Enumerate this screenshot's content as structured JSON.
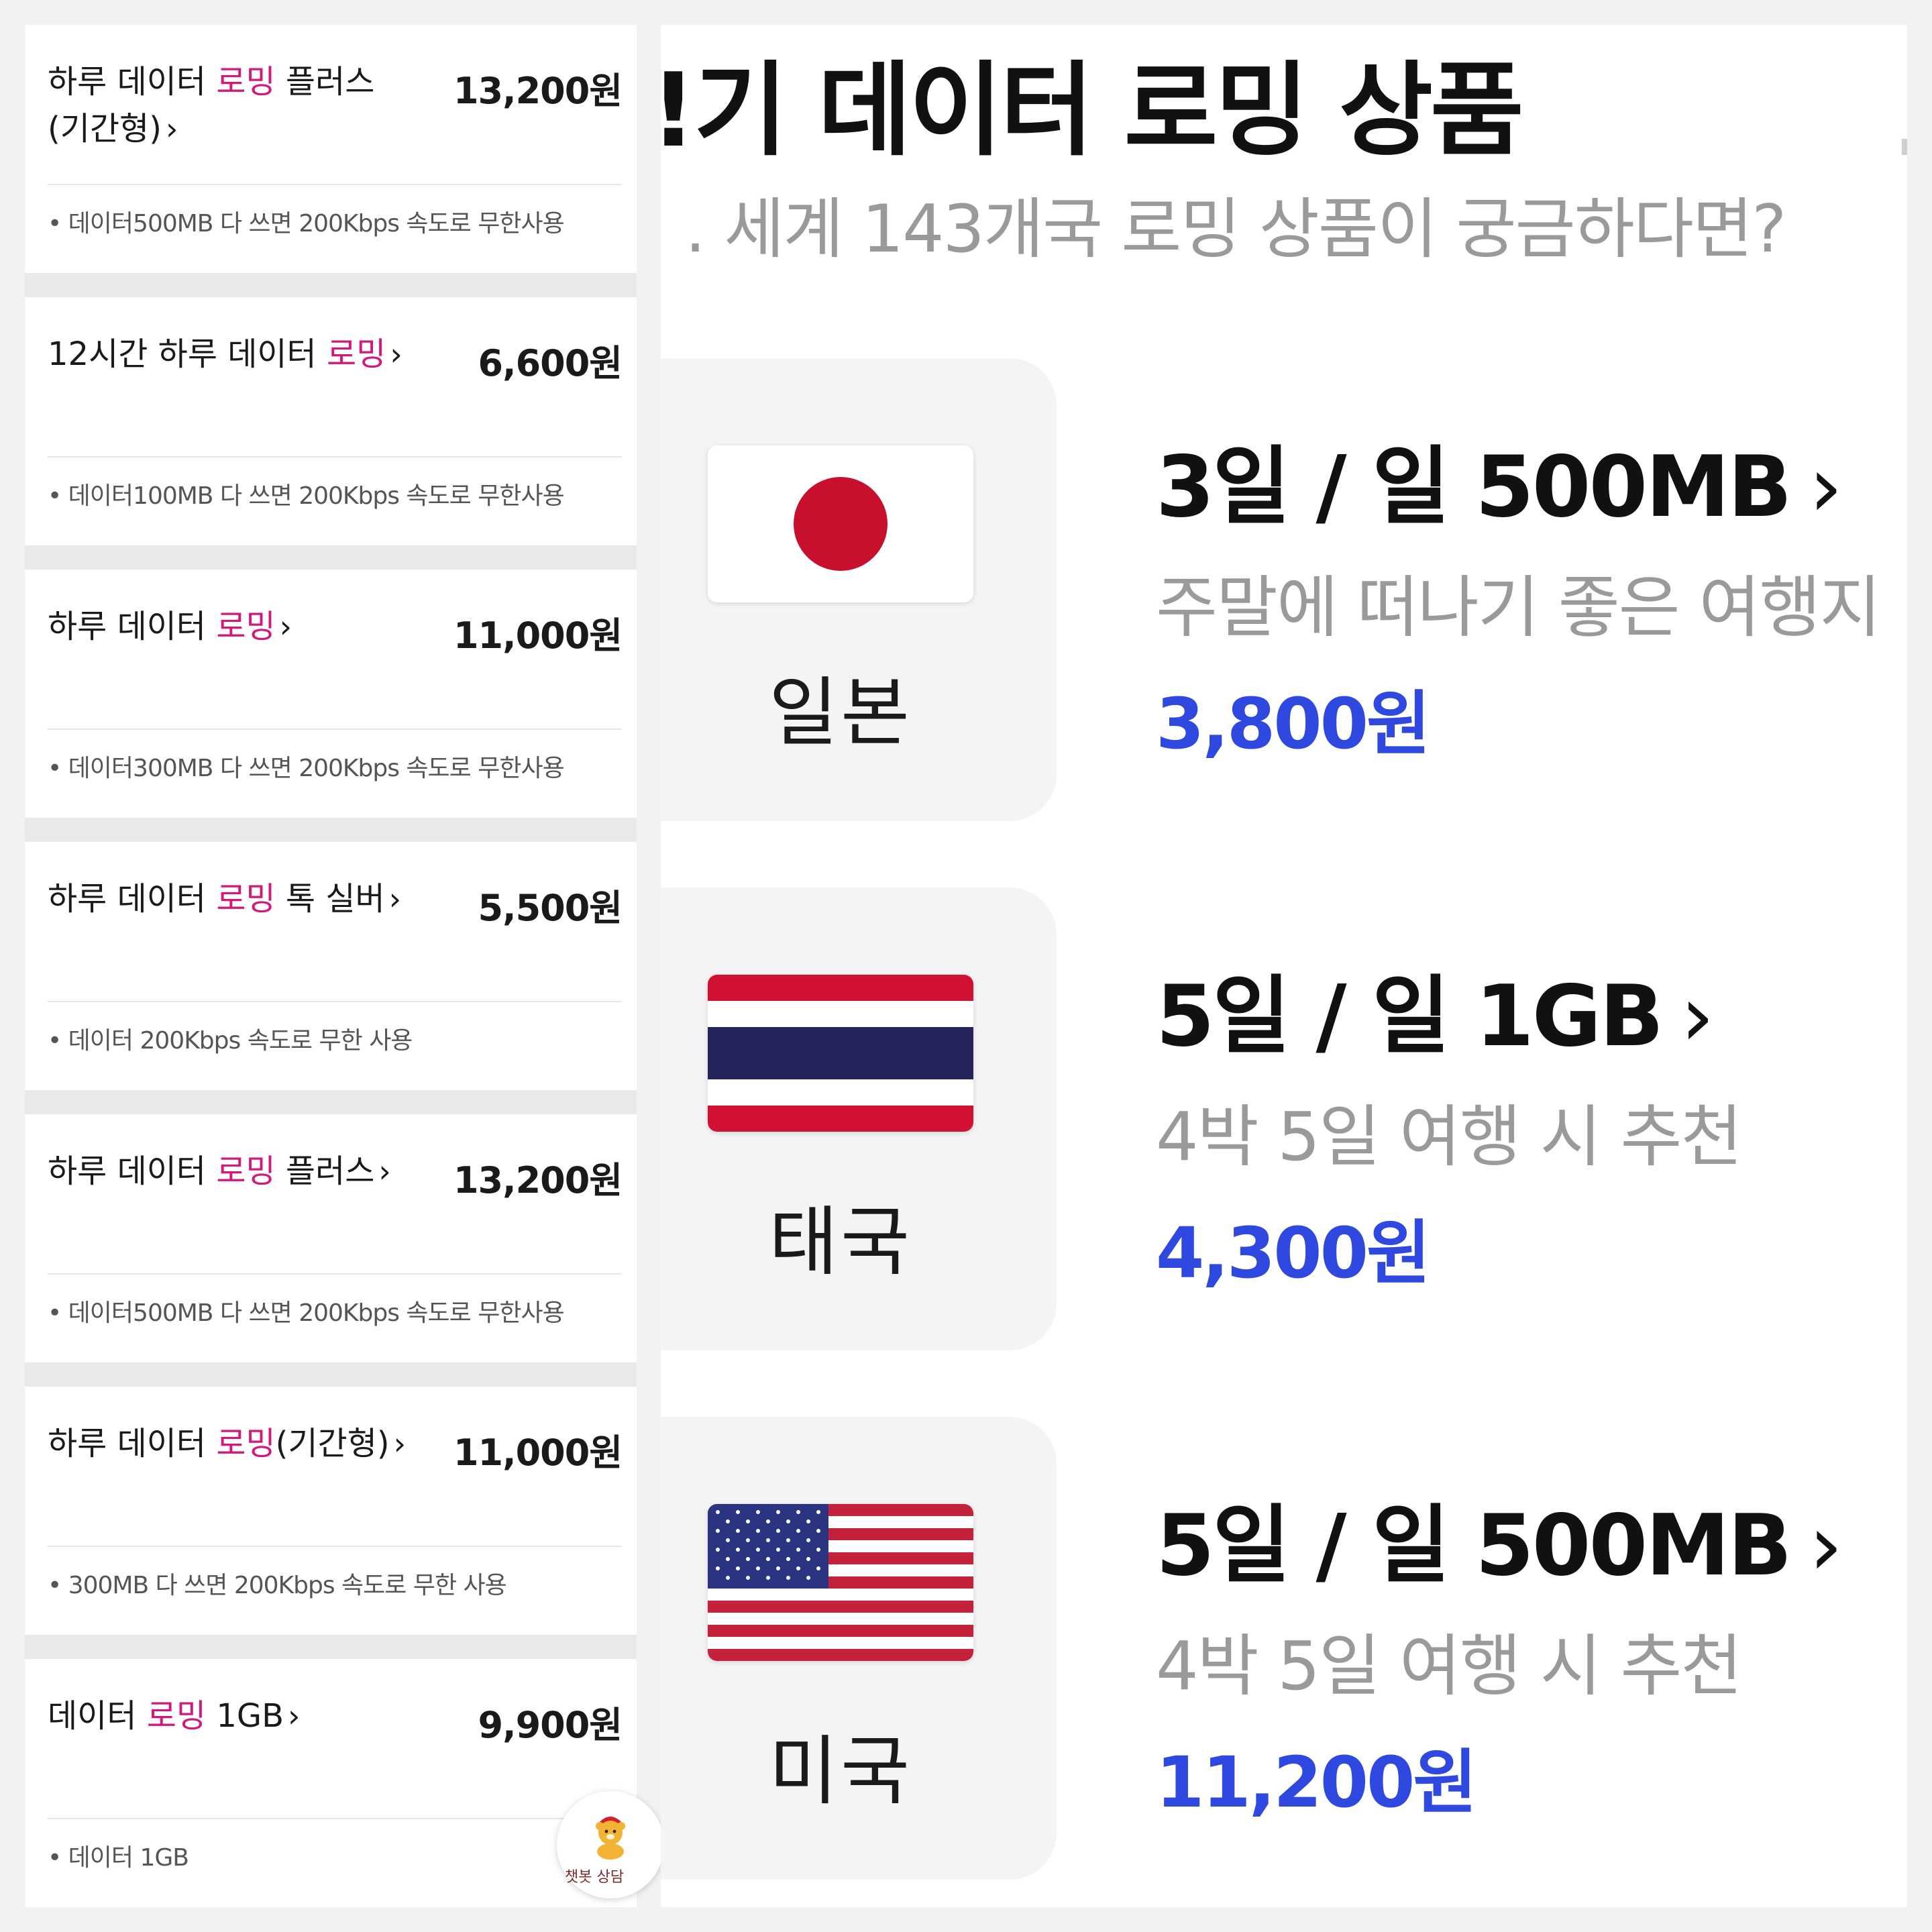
{
  "left_list": {
    "items": [
      {
        "name_prefix": "하루 데이터 ",
        "highlight": "로밍",
        "name_suffix": " 플러스\n(기간형)",
        "chevron": "›",
        "price": "13,200원",
        "desc": "• 데이터500MB 다 쓰면 200Kbps 속도로 무한사용"
      },
      {
        "name_prefix": "12시간 하루 데이터 ",
        "highlight": "로밍",
        "name_suffix": "",
        "chevron": "›",
        "price": "6,600원",
        "desc": "• 데이터100MB 다 쓰면 200Kbps 속도로 무한사용"
      },
      {
        "name_prefix": "하루 데이터 ",
        "highlight": "로밍",
        "name_suffix": "",
        "chevron": "›",
        "price": "11,000원",
        "desc": "• 데이터300MB 다 쓰면 200Kbps 속도로 무한사용"
      },
      {
        "name_prefix": "하루 데이터 ",
        "highlight": "로밍",
        "name_suffix": " 톡 실버",
        "chevron": "›",
        "price": "5,500원",
        "desc": "• 데이터 200Kbps 속도로 무한 사용"
      },
      {
        "name_prefix": "하루 데이터 ",
        "highlight": "로밍",
        "name_suffix": " 플러스",
        "chevron": "›",
        "price": "13,200원",
        "desc": "• 데이터500MB 다 쓰면 200Kbps 속도로 무한사용"
      },
      {
        "name_prefix": "하루 데이터 ",
        "highlight": "로밍",
        "name_suffix": "(기간형)",
        "chevron": "›",
        "price": "11,000원",
        "desc": "• 300MB 다 쓰면 200Kbps 속도로 무한 사용"
      },
      {
        "name_prefix": "데이터 ",
        "highlight": "로밍",
        "name_suffix": " 1GB",
        "chevron": "›",
        "price": "9,900원",
        "desc": "• 데이터 1GB"
      }
    ],
    "highlight_color": "#d3187a",
    "chatbot": {
      "label": "챗봇 상담",
      "icon": "bear-mascot-icon"
    }
  },
  "right_panel": {
    "title": "!기 데이터 로밍 상품",
    "subtitle": ". 세계 143개국 로밍 상품이 궁금하다면?",
    "price_color": "#2f48e0",
    "countries": [
      {
        "flag": "japan-flag-icon",
        "country": "일본",
        "plan": "3일 / 일 500MB",
        "chevron": "›",
        "desc": "주말에 떠나기 좋은 여행지",
        "price": "3,800원"
      },
      {
        "flag": "thailand-flag-icon",
        "country": "태국",
        "plan": "5일 / 일 1GB",
        "chevron": "›",
        "desc": "4박 5일 여행 시 추천",
        "price": "4,300원"
      },
      {
        "flag": "usa-flag-icon",
        "country": "미국",
        "plan": "5일 / 일 500MB",
        "chevron": "›",
        "desc": "4박 5일 여행 시 추천",
        "price": "11,200원"
      }
    ]
  }
}
